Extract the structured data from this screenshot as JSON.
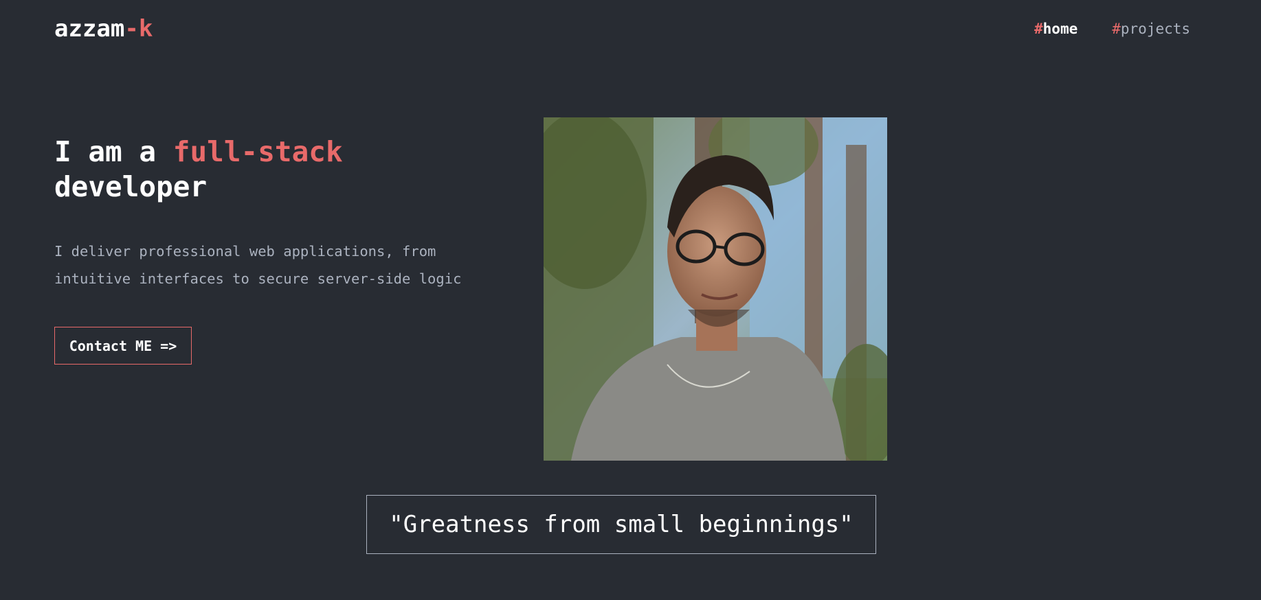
{
  "header": {
    "logo_main": "azzam",
    "logo_accent": "-k",
    "nav": [
      {
        "hash": "#",
        "label": "home",
        "active": true
      },
      {
        "hash": "#",
        "label": "projects",
        "active": false
      }
    ]
  },
  "hero": {
    "headline_prefix": "I am a ",
    "headline_accent": "full-stack",
    "headline_suffix": "developer",
    "description_line1": "I deliver professional web applications, from",
    "description_line2": "intuitive interfaces to secure server-side logic",
    "cta_label": "Contact ME =>"
  },
  "quote": {
    "text": "\"Greatness from small beginnings\""
  },
  "colors": {
    "background": "#282c33",
    "accent": "#e86a6a",
    "muted": "#abb2bf",
    "text": "#ffffff"
  }
}
